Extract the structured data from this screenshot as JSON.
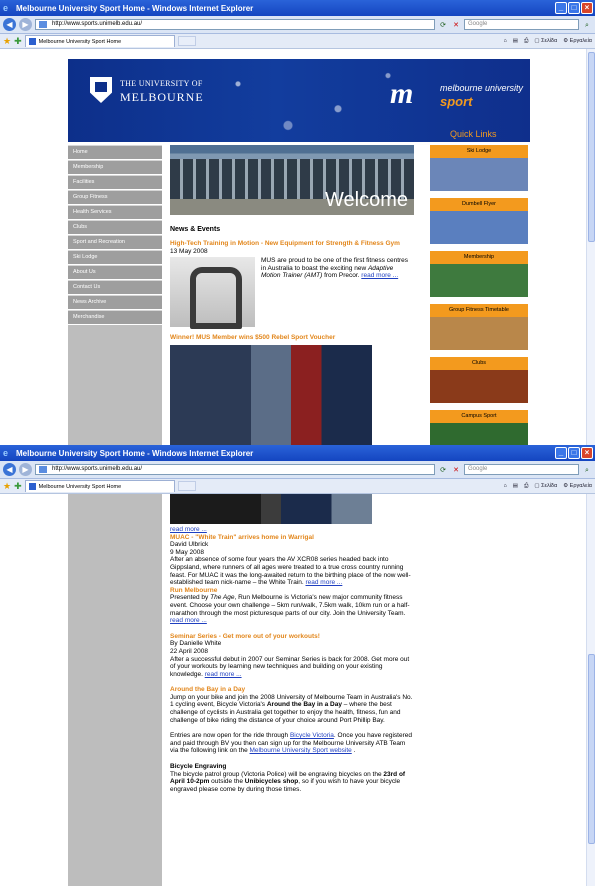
{
  "browser": {
    "window_title": "Melbourne University Sport Home - Windows Internet Explorer",
    "address": "http://www.sports.unimelb.edu.au/",
    "search_placeholder": "Google",
    "tab_title": "Melbourne University Sport Home",
    "cmd_page": "Σελίδα",
    "cmd_tools": "Εργαλεία"
  },
  "banner": {
    "university_line1": "THE UNIVERSITY OF",
    "university_line2": "MELBOURNE",
    "sport_logo_line1": "melbourne university",
    "sport_logo_line2": "sport",
    "quick_links": "Quick Links"
  },
  "menu": [
    "Home",
    "Membership",
    "Facilities",
    "Group Fitness",
    "Health Services",
    "Clubs",
    "Sport and Recreation",
    "Ski Lodge",
    "About Us",
    "Contact Us",
    "News Archive",
    "Merchandise"
  ],
  "welcome_text": "Welcome",
  "news": {
    "heading": "News & Events",
    "a1": {
      "title": "High-Tech Training in Motion - New Equipment for Strength & Fitness Gym",
      "date": "13 May 2008",
      "body_pre": "MUS are proud to be one of the first fitness centres in Australia to boast the exciting new ",
      "body_em": "Adaptive Motion Trainer (AMT)",
      "body_post": " from Precor. ",
      "more": "read more ..."
    },
    "a2": {
      "title": "Winner! MUS Member wins $500 Rebel Sport Voucher",
      "more": "read more ..."
    },
    "a3": {
      "title": "MUAC - \"White Train\" arrives home in Warrigal",
      "author": "David Ulbrick",
      "date": "9 May 2008",
      "body": "After an absence of some four years the AV XCR08 series headed back into Gippsland, where runners of all ages were treated to a true cross country running feast.  For MUAC it was the long-awaited return to the birthing place of the now well-established team nick-name – the White Train. ",
      "more": "read more ..."
    },
    "a4": {
      "title": "Run Melbourne",
      "body_pre": "Presented by ",
      "body_em": "The Age",
      "body_post": ", Run Melbourne is Victoria's new major community fitness event. Choose your own challenge – 5km run/walk, 7.5km walk, 10km run or a half-marathon through the most picturesque parts of our city. Join the University Team.",
      "more": "read more ..."
    },
    "a5": {
      "title": "Seminar Series - Get more out of your workouts!",
      "author": "By Danielle White",
      "date": "22 April 2008",
      "body": "After a successful debut in 2007 our Seminar Series is back for 2008. Get more out of your workouts by learning new techniques and building on your existing knowledge. ",
      "more": "read more ..."
    },
    "a6": {
      "title": "Around the Bay in a Day",
      "body_pre": "Jump on your bike and join the 2008 University of Melbourne Team in Australia's No. 1 cycling event, Bicycle Victoria's ",
      "body_bold": "Around the Bay in a Day",
      "body_post": " – where the best challenge of cyclists in Australia get together to enjoy the health, fitness, fun and challenge of bike riding the distance of your choice around Port Phillip Bay.",
      "p2_pre": "Entries are now open for the ride through ",
      "p2_link1": "Bicycle Victoria",
      "p2_mid": ". Once you have registered and paid through BV you then can sign up for the Melbourne University ATB Team via the following link on the ",
      "p2_link2": "Melbourne University Sport website",
      "p2_post": " ."
    },
    "a7": {
      "title": "Bicycle Engraving",
      "body_pre": "The bicycle patrol group (Victoria Police) will be engraving bicycles on the ",
      "body_bold1": "23rd of April 10-2pm",
      "body_mid": " outside the ",
      "body_bold2": "Unibicycles shop",
      "body_post": ", so if you wish to have your bicycle engraved please come by during those times."
    }
  },
  "quick_links": [
    {
      "label": "Ski Lodge",
      "color": "#6b86b8"
    },
    {
      "label": "Dumbell Flyer",
      "color": "#5a7fbf"
    },
    {
      "label": "Membership",
      "color": "#3e7a3e"
    },
    {
      "label": "Group Fitness Timetable",
      "color": "#b9874a"
    },
    {
      "label": "Clubs",
      "color": "#8a3a1a"
    },
    {
      "label": "Campus Sport",
      "color": "#2f6a2f"
    }
  ],
  "colors": {
    "accent": "#f39a1e",
    "banner": "#0d2f8a",
    "menu": "#9e9e9e",
    "link": "#1f3fc0"
  }
}
